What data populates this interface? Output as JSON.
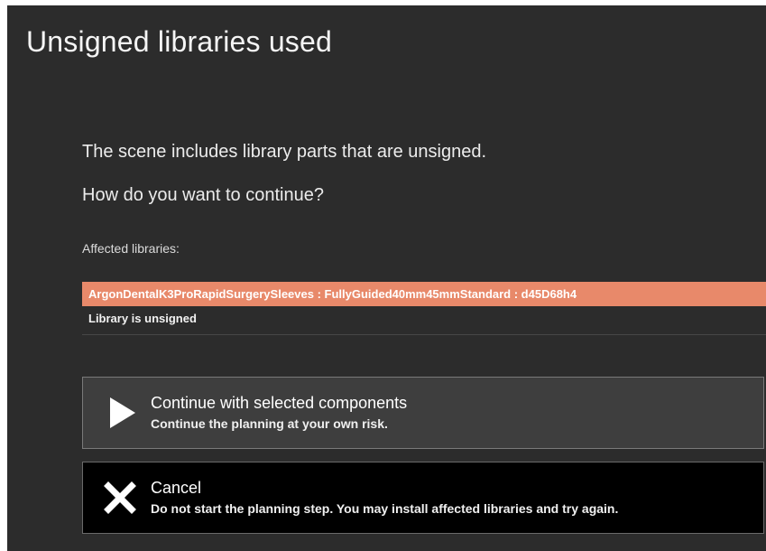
{
  "dialog": {
    "title": "Unsigned libraries used",
    "message_line1": "The scene includes library parts that are unsigned.",
    "message_line2": "How do you want to continue?",
    "affected_label": "Affected libraries:",
    "libraries": [
      {
        "name": "ArgonDentalK3ProRapidSurgerySleeves : FullyGuided40mm45mmStandard : d45D68h4",
        "status": "Library is unsigned"
      }
    ],
    "options": [
      {
        "icon": "play-icon",
        "title": "Continue with selected components",
        "description": "Continue the planning at your own risk."
      },
      {
        "icon": "close-icon",
        "title": "Cancel",
        "description": "Do not start the planning step. You may install affected libraries and try again."
      }
    ],
    "colors": {
      "background": "#2c2c2c",
      "highlight_row": "#e8896a",
      "continue_button": "#3e3e3e",
      "cancel_button": "#000000"
    }
  }
}
